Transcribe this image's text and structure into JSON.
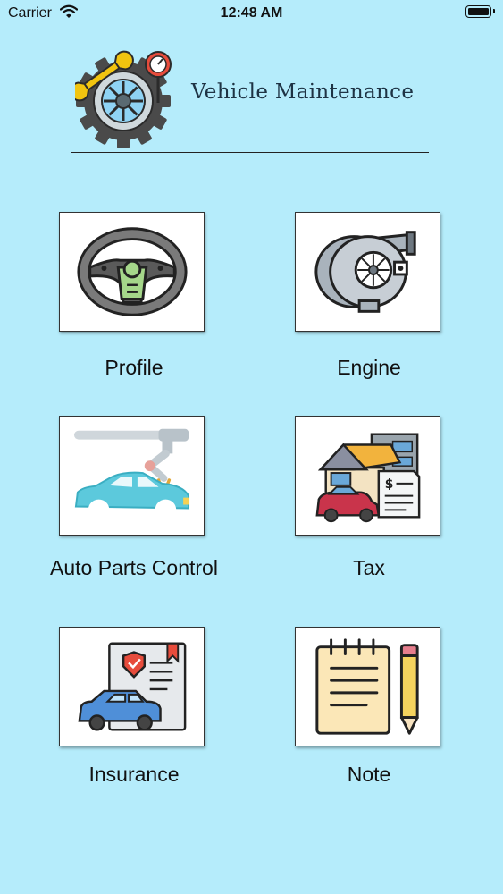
{
  "status_bar": {
    "carrier": "Carrier",
    "time": "12:48 AM"
  },
  "header": {
    "title": "Vehicle Maintenance",
    "logo_icon": "gear-wrench-gauge-icon"
  },
  "menu": [
    {
      "label": "Profile",
      "icon": "steering-wheel-icon"
    },
    {
      "label": "Engine",
      "icon": "turbocharger-icon"
    },
    {
      "label": "Auto Parts Control",
      "icon": "robotic-arm-car-icon"
    },
    {
      "label": "Tax",
      "icon": "house-car-tax-document-icon"
    },
    {
      "label": "Insurance",
      "icon": "car-insurance-document-icon"
    },
    {
      "label": "Note",
      "icon": "notepad-pencil-icon"
    }
  ],
  "colors": {
    "background": "#b5ecfb",
    "tile_background": "#ffffff",
    "title_text": "#1e3344"
  }
}
